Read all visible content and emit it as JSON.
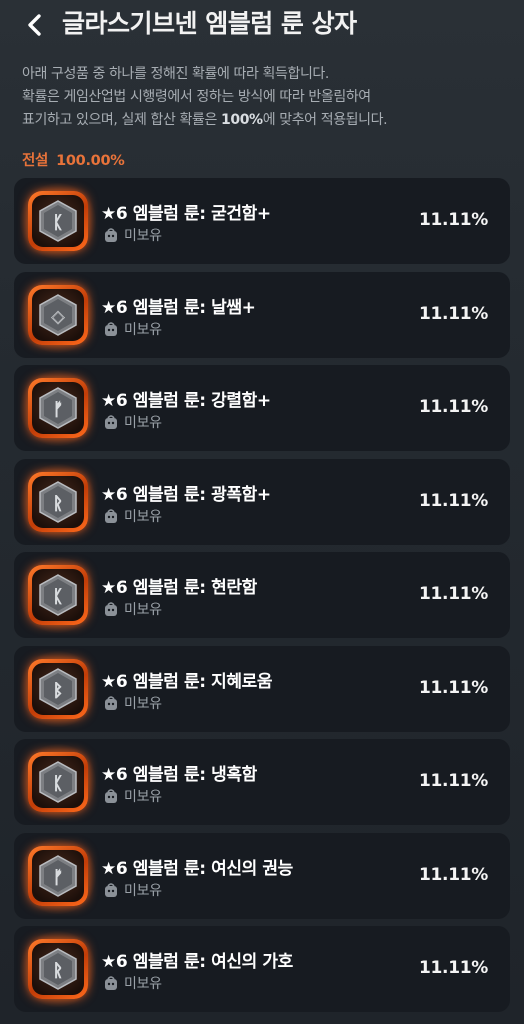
{
  "header": {
    "title": "글라스기브넨 엠블럼 룬 상자",
    "back_icon": "chevron-left-icon"
  },
  "description": {
    "line1": "아래 구성품 중 하나를 정해진 확률에 따라 획득합니다.",
    "line2": "확률은 게임산업법 시행령에서 정하는 방식에 따라 반올림하여",
    "line3_pre": "표기하고 있으며, 실제 합산 확률은 ",
    "line3_bold": "100%",
    "line3_post": "에 맞추어 적용됩니다."
  },
  "grade": {
    "label": "전설",
    "value": "100.00%",
    "color": "#e8733a"
  },
  "items": [
    {
      "name": "★6 엠블럼 룬: 굳건함+",
      "status": "미보유",
      "probability": "11.11%",
      "glyph": "ᛕ"
    },
    {
      "name": "★6 엠블럼 룬: 날쌤+",
      "status": "미보유",
      "probability": "11.11%",
      "glyph": "◇"
    },
    {
      "name": "★6 엠블럼 룬: 강렬함+",
      "status": "미보유",
      "probability": "11.11%",
      "glyph": "ᚠ"
    },
    {
      "name": "★6 엠블럼 룬: 광폭함+",
      "status": "미보유",
      "probability": "11.11%",
      "glyph": "ᚱ"
    },
    {
      "name": "★6 엠블럼 룬: 현란함",
      "status": "미보유",
      "probability": "11.11%",
      "glyph": "ᛕ"
    },
    {
      "name": "★6 엠블럼 룬: 지혜로움",
      "status": "미보유",
      "probability": "11.11%",
      "glyph": "ᛒ"
    },
    {
      "name": "★6 엠블럼 룬: 냉혹함",
      "status": "미보유",
      "probability": "11.11%",
      "glyph": "ᛕ"
    },
    {
      "name": "★6 엠블럼 룬: 여신의 권능",
      "status": "미보유",
      "probability": "11.11%",
      "glyph": "ᚠ"
    },
    {
      "name": "★6 엠블럼 룬: 여신의 가호",
      "status": "미보유",
      "probability": "11.11%",
      "glyph": "ᚱ"
    }
  ],
  "icons": {
    "rune": "rune-stone-icon",
    "owned": "bag-icon"
  }
}
